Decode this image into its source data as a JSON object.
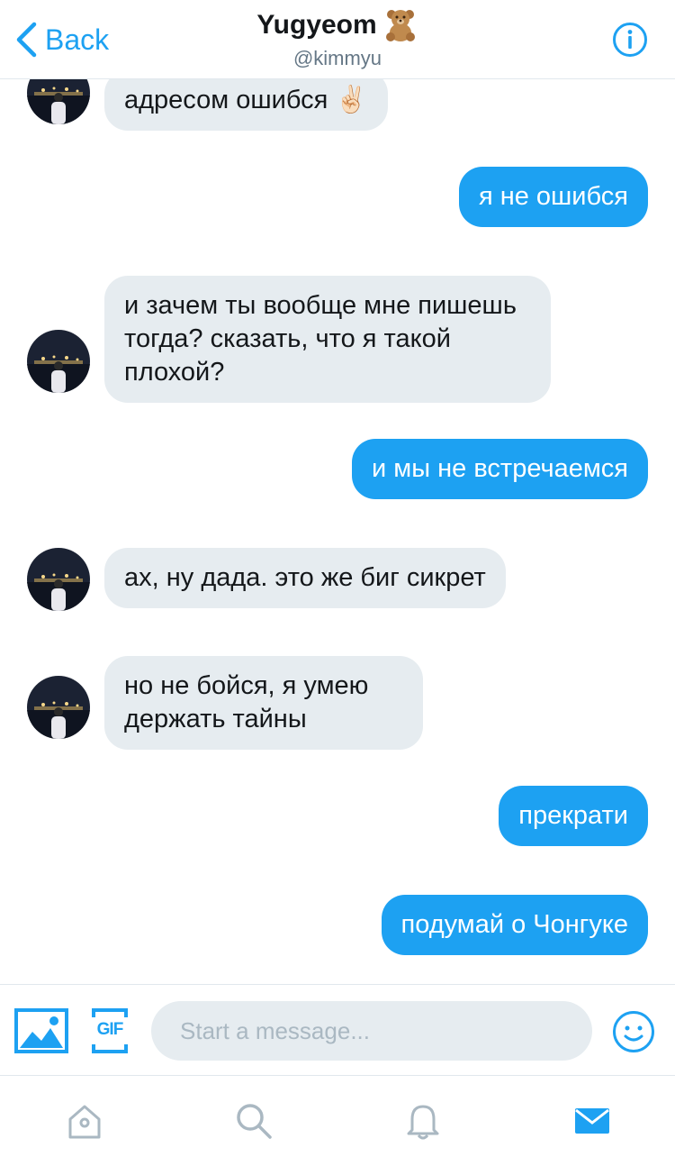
{
  "header": {
    "back_label": "Back",
    "name": "Yugyeom",
    "handle": "@kimmyu"
  },
  "messages": [
    {
      "side": "in",
      "text": "адресом ошибся ✌🏻"
    },
    {
      "side": "out",
      "text": "я не ошибся"
    },
    {
      "side": "in",
      "text": "и зачем ты вообще мне пишешь тогда? сказать, что я такой плохой?"
    },
    {
      "side": "out",
      "text": "и мы не встречаемся"
    },
    {
      "side": "in",
      "text": "ах, ну дада. это же биг сикрет"
    },
    {
      "side": "in",
      "text": "но не бойся, я умею держать тайны"
    },
    {
      "side": "out",
      "text": "прекрати"
    },
    {
      "side": "out",
      "text": "подумай о Чонгуке"
    }
  ],
  "composer": {
    "placeholder": "Start a message...",
    "gif_label": "GIF"
  },
  "tabs": [
    "home-tab",
    "search-tab",
    "notifications-tab",
    "messages-tab"
  ],
  "colors": {
    "accent": "#1da1f2",
    "incoming_bubble": "#e6ecf0",
    "inactive_icon": "#aab8c2"
  }
}
